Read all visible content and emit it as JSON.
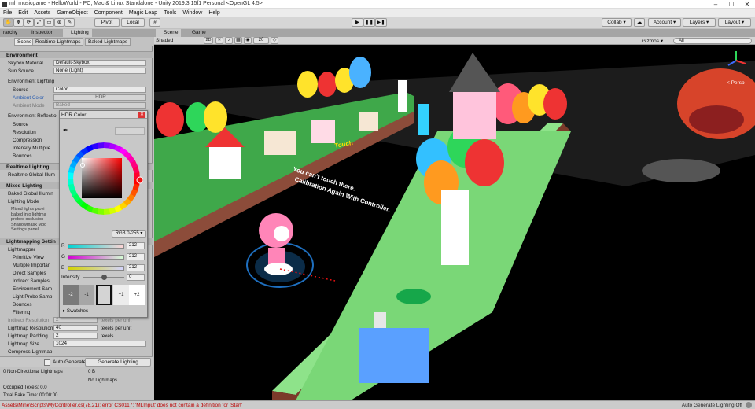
{
  "window": {
    "title": "ml_musicgame - HelloWorld - PC, Mac & Linux Standalone - Unity 2019.3.15f1 Personal <OpenGL 4.5>",
    "minimize": "–",
    "maximize": "☐",
    "close": "✕"
  },
  "menu": [
    "File",
    "Edit",
    "Assets",
    "GameObject",
    "Component",
    "Magic Leap",
    "Tools",
    "Window",
    "Help"
  ],
  "toolbar": {
    "pivot": "Pivot",
    "local": "Local",
    "collab": "Collab ▾",
    "account": "Account ▾",
    "layers": "Layers ▾",
    "layout": "Layout ▾"
  },
  "left_tabs": {
    "hierarchy": "rarchy",
    "inspector": "Inspector",
    "lighting": "Lighting"
  },
  "lighting_tabs": [
    "Scene",
    "Realtime Lightmaps",
    "Baked Lightmaps"
  ],
  "environment": {
    "header": "Environment",
    "skybox_label": "Skybox Material",
    "skybox_value": "Default-Skybox",
    "sun_label": "Sun Source",
    "sun_value": "None (Light)",
    "env_lighting": "Environment Lighting",
    "source_label": "Source",
    "source_value": "Color",
    "ambient_label": "Ambient Color",
    "ambient_value": "HDR",
    "ambient_mode_label": "Ambient Mode",
    "ambient_mode_value": "Baked",
    "env_reflections": "Environment Reflectio",
    "refl_source": "Source",
    "resolution": "Resolution",
    "compression": "Compression",
    "intensity_mult": "Intensity Multiplie",
    "bounces": "Bounces"
  },
  "realtime": {
    "header": "Realtime Lighting",
    "gi_label": "Realtime Global Illum"
  },
  "mixed": {
    "header": "Mixed Lighting",
    "baked_gi": "Baked Global Illumin",
    "mode": "Lighting Mode",
    "help": [
      "Mixed lights provi",
      "baked into lightma",
      "probes occlusion",
      "Shadowmask Mod",
      "Settings panel."
    ]
  },
  "lightmapping": {
    "header": "Lightmapping Settin",
    "lightmapper": "Lightmapper",
    "prioritize": "Prioritize View",
    "multi": "Multiple Importan",
    "direct": "Direct Samples",
    "indirect": "Indirect Samples",
    "env_samples": "Environment Sam",
    "probe_samples": "Light Probe Samp",
    "bounces": "Bounces",
    "filtering": "Filtering",
    "indirect_res_label": "Indirect Resolution",
    "indirect_res_value": "2",
    "indirect_res_unit": "texels per unit",
    "lm_res_label": "Lightmap Resolution",
    "lm_res_value": "40",
    "lm_res_unit": "texels per unit",
    "lm_pad_label": "Lightmap Padding",
    "lm_pad_value": "2",
    "lm_pad_unit": "texels",
    "lm_size_label": "Lightmap Size",
    "lm_size_value": "1024",
    "compress_label": "Compress Lightmap",
    "auto_generate": "Auto Generate",
    "generate_button": "Generate Lighting"
  },
  "bake_stats": {
    "row1_label": "0 Non-Directional Lightmaps",
    "row1_value": "0 B",
    "row2_value": "No Lightmaps",
    "occupied": "Occupied Texels: 0.0",
    "bake_time": "Total Bake Time: 00:00:00"
  },
  "hdr_popup": {
    "title": "HDR Color",
    "mode": "RGB 0-255 ▾",
    "channels": [
      {
        "label": "R",
        "value": "212",
        "color": "#d4d4d4"
      },
      {
        "label": "G",
        "value": "212",
        "color": "#d4d4d4"
      },
      {
        "label": "B",
        "value": "212",
        "color": "#d4d4d4"
      }
    ],
    "intensity_label": "Intensity",
    "intensity_value": "0",
    "swatches_buttons": [
      "-2",
      "-1",
      "",
      "+1",
      "+2"
    ],
    "swatches_label": "▸ Swatches"
  },
  "scene_tabs": {
    "scene": "Scene",
    "game": "Game"
  },
  "scene_bar": {
    "shading": "Shaded",
    "mode2d": "2D",
    "gizmos": "Gizmos ▾",
    "search": "All",
    "fx_count": "20"
  },
  "scene_overlay": {
    "line1": "Touch",
    "line2": "You can't touch there.",
    "line3": "Calibration Again With Controller.",
    "persp": "< Persp"
  },
  "status": {
    "error": "Assets\\Mine\\Scripts\\MyController.cs(78,21): error CS0117: 'MLInput' does not contain a definition for 'Start'",
    "auto_generate": "Auto Generate Lighting Off"
  }
}
